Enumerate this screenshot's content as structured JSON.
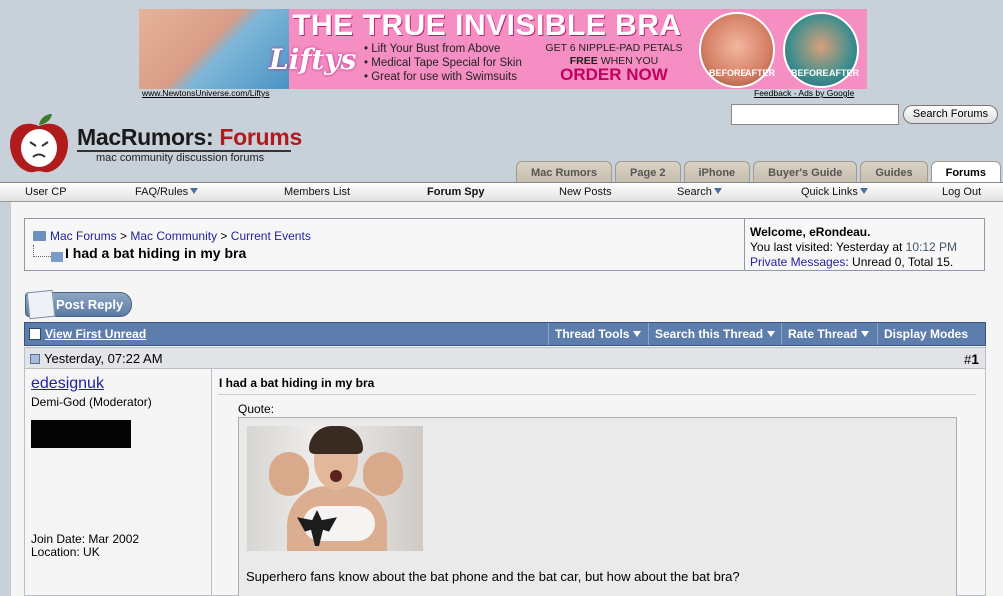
{
  "ad": {
    "headline": "THE TRUE INVISIBLE BRA",
    "brand": "Liftys",
    "bullets": [
      "Lift Your Bust from Above",
      "Medical Tape Special for Skin",
      "Great for use with Swimsuits"
    ],
    "offer_line1": "GET 6 NIPPLE-PAD PETALS",
    "offer_free": "FREE",
    "offer_line2": "WHEN YOU",
    "cta": "ORDER NOW",
    "before_label": "BEFORE",
    "after_label": "AFTER",
    "link_text": "www.NewtonsUniverse.com/Liftys",
    "feedback_text": "Feedback - Ads by Google"
  },
  "search": {
    "button_label": "Search Forums",
    "value": ""
  },
  "logo": {
    "brand_main": "MacRumors:",
    "brand_accent": "Forums",
    "tagline": "mac community discussion forums"
  },
  "tabs": [
    {
      "label": "Mac Rumors"
    },
    {
      "label": "Page 2"
    },
    {
      "label": "iPhone"
    },
    {
      "label": "Buyer's Guide"
    },
    {
      "label": "Guides"
    },
    {
      "label": "Forums"
    }
  ],
  "nav": {
    "user_cp": "User CP",
    "faq": "FAQ/Rules",
    "members": "Members List",
    "spy": "Forum Spy",
    "new_posts": "New Posts",
    "search": "Search",
    "quick_links": "Quick Links",
    "logout": "Log Out"
  },
  "breadcrumb": {
    "items": [
      "Mac Forums",
      "Mac Community",
      "Current Events"
    ],
    "separator": ">",
    "thread_title": "I had a bat hiding in my bra"
  },
  "welcome": {
    "greeting": "Welcome, eRondeau.",
    "last_visited_label": "You last visited: Yesterday at",
    "last_visited_time": "10:12 PM",
    "pm_link": "Private Messages",
    "pm_status": ": Unread 0, Total 15."
  },
  "post_reply_label": "Post Reply",
  "thread_tools": {
    "view_first_unread": "View First Unread",
    "thread_tools": "Thread Tools",
    "search_thread": "Search this Thread",
    "rate_thread": "Rate Thread",
    "display_modes": "Display Modes"
  },
  "post": {
    "date": "Yesterday, 07:22 AM",
    "number_prefix": "#",
    "number": "1",
    "username": "edesignuk",
    "user_title": "Demi-God (Moderator)",
    "join_date": "Join Date: Mar 2002",
    "location": "Location: UK",
    "title": "I had a bat hiding in my bra",
    "quote_label": "Quote:",
    "quote_text": "Superhero fans know about the bat phone and the bat car, but how about the bat bra?"
  }
}
